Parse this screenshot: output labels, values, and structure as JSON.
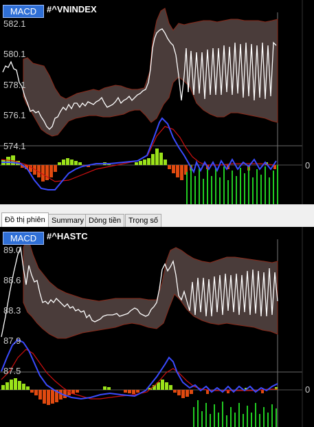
{
  "top_panel": {
    "indicator_badge": "MACD",
    "symbol": "#^VNINDEX",
    "y_labels": [
      "582.1",
      "580.1",
      "578.1",
      "576.1",
      "574.1"
    ],
    "zero_label": "0"
  },
  "tabs": [
    {
      "label": "Đồ thị phiên",
      "active": true
    },
    {
      "label": "Summary",
      "active": false
    },
    {
      "label": "Dòng tiền",
      "active": false
    },
    {
      "label": "Trọng số",
      "active": false
    }
  ],
  "bottom_panel": {
    "indicator_badge": "MACD",
    "symbol": "#^HASTC",
    "y_labels": [
      "89.0",
      "88.6",
      "88.3",
      "87.9",
      "87.5"
    ],
    "zero_label": "0"
  },
  "colors": {
    "background": "#000000",
    "price_line": "#ffffff",
    "band_fill": "#4a3c3a",
    "band_edge": "#8b2a1a",
    "macd_line": "#3b4bff",
    "signal_line": "#d01010",
    "hist_positive": "#9be21a",
    "hist_negative": "#e04a10",
    "volume": "#22cc22",
    "badge": "#2f6fd6"
  }
}
